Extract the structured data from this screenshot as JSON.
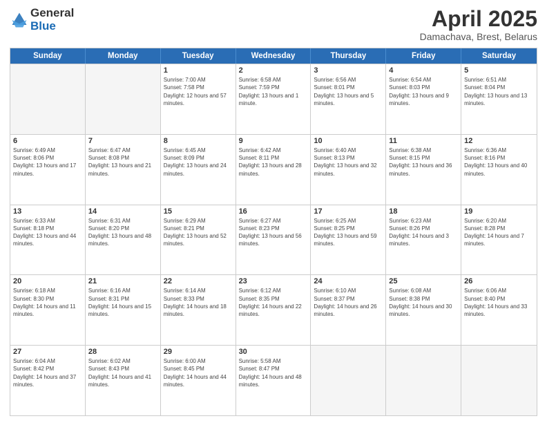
{
  "header": {
    "logo_general": "General",
    "logo_blue": "Blue",
    "month_title": "April 2025",
    "subtitle": "Damachava, Brest, Belarus"
  },
  "weekdays": [
    "Sunday",
    "Monday",
    "Tuesday",
    "Wednesday",
    "Thursday",
    "Friday",
    "Saturday"
  ],
  "weeks": [
    [
      {
        "day": "",
        "empty": true
      },
      {
        "day": "",
        "empty": true
      },
      {
        "day": "1",
        "sunrise": "Sunrise: 7:00 AM",
        "sunset": "Sunset: 7:58 PM",
        "daylight": "Daylight: 12 hours and 57 minutes."
      },
      {
        "day": "2",
        "sunrise": "Sunrise: 6:58 AM",
        "sunset": "Sunset: 7:59 PM",
        "daylight": "Daylight: 13 hours and 1 minute."
      },
      {
        "day": "3",
        "sunrise": "Sunrise: 6:56 AM",
        "sunset": "Sunset: 8:01 PM",
        "daylight": "Daylight: 13 hours and 5 minutes."
      },
      {
        "day": "4",
        "sunrise": "Sunrise: 6:54 AM",
        "sunset": "Sunset: 8:03 PM",
        "daylight": "Daylight: 13 hours and 9 minutes."
      },
      {
        "day": "5",
        "sunrise": "Sunrise: 6:51 AM",
        "sunset": "Sunset: 8:04 PM",
        "daylight": "Daylight: 13 hours and 13 minutes."
      }
    ],
    [
      {
        "day": "6",
        "sunrise": "Sunrise: 6:49 AM",
        "sunset": "Sunset: 8:06 PM",
        "daylight": "Daylight: 13 hours and 17 minutes."
      },
      {
        "day": "7",
        "sunrise": "Sunrise: 6:47 AM",
        "sunset": "Sunset: 8:08 PM",
        "daylight": "Daylight: 13 hours and 21 minutes."
      },
      {
        "day": "8",
        "sunrise": "Sunrise: 6:45 AM",
        "sunset": "Sunset: 8:09 PM",
        "daylight": "Daylight: 13 hours and 24 minutes."
      },
      {
        "day": "9",
        "sunrise": "Sunrise: 6:42 AM",
        "sunset": "Sunset: 8:11 PM",
        "daylight": "Daylight: 13 hours and 28 minutes."
      },
      {
        "day": "10",
        "sunrise": "Sunrise: 6:40 AM",
        "sunset": "Sunset: 8:13 PM",
        "daylight": "Daylight: 13 hours and 32 minutes."
      },
      {
        "day": "11",
        "sunrise": "Sunrise: 6:38 AM",
        "sunset": "Sunset: 8:15 PM",
        "daylight": "Daylight: 13 hours and 36 minutes."
      },
      {
        "day": "12",
        "sunrise": "Sunrise: 6:36 AM",
        "sunset": "Sunset: 8:16 PM",
        "daylight": "Daylight: 13 hours and 40 minutes."
      }
    ],
    [
      {
        "day": "13",
        "sunrise": "Sunrise: 6:33 AM",
        "sunset": "Sunset: 8:18 PM",
        "daylight": "Daylight: 13 hours and 44 minutes."
      },
      {
        "day": "14",
        "sunrise": "Sunrise: 6:31 AM",
        "sunset": "Sunset: 8:20 PM",
        "daylight": "Daylight: 13 hours and 48 minutes."
      },
      {
        "day": "15",
        "sunrise": "Sunrise: 6:29 AM",
        "sunset": "Sunset: 8:21 PM",
        "daylight": "Daylight: 13 hours and 52 minutes."
      },
      {
        "day": "16",
        "sunrise": "Sunrise: 6:27 AM",
        "sunset": "Sunset: 8:23 PM",
        "daylight": "Daylight: 13 hours and 56 minutes."
      },
      {
        "day": "17",
        "sunrise": "Sunrise: 6:25 AM",
        "sunset": "Sunset: 8:25 PM",
        "daylight": "Daylight: 13 hours and 59 minutes."
      },
      {
        "day": "18",
        "sunrise": "Sunrise: 6:23 AM",
        "sunset": "Sunset: 8:26 PM",
        "daylight": "Daylight: 14 hours and 3 minutes."
      },
      {
        "day": "19",
        "sunrise": "Sunrise: 6:20 AM",
        "sunset": "Sunset: 8:28 PM",
        "daylight": "Daylight: 14 hours and 7 minutes."
      }
    ],
    [
      {
        "day": "20",
        "sunrise": "Sunrise: 6:18 AM",
        "sunset": "Sunset: 8:30 PM",
        "daylight": "Daylight: 14 hours and 11 minutes."
      },
      {
        "day": "21",
        "sunrise": "Sunrise: 6:16 AM",
        "sunset": "Sunset: 8:31 PM",
        "daylight": "Daylight: 14 hours and 15 minutes."
      },
      {
        "day": "22",
        "sunrise": "Sunrise: 6:14 AM",
        "sunset": "Sunset: 8:33 PM",
        "daylight": "Daylight: 14 hours and 18 minutes."
      },
      {
        "day": "23",
        "sunrise": "Sunrise: 6:12 AM",
        "sunset": "Sunset: 8:35 PM",
        "daylight": "Daylight: 14 hours and 22 minutes."
      },
      {
        "day": "24",
        "sunrise": "Sunrise: 6:10 AM",
        "sunset": "Sunset: 8:37 PM",
        "daylight": "Daylight: 14 hours and 26 minutes."
      },
      {
        "day": "25",
        "sunrise": "Sunrise: 6:08 AM",
        "sunset": "Sunset: 8:38 PM",
        "daylight": "Daylight: 14 hours and 30 minutes."
      },
      {
        "day": "26",
        "sunrise": "Sunrise: 6:06 AM",
        "sunset": "Sunset: 8:40 PM",
        "daylight": "Daylight: 14 hours and 33 minutes."
      }
    ],
    [
      {
        "day": "27",
        "sunrise": "Sunrise: 6:04 AM",
        "sunset": "Sunset: 8:42 PM",
        "daylight": "Daylight: 14 hours and 37 minutes."
      },
      {
        "day": "28",
        "sunrise": "Sunrise: 6:02 AM",
        "sunset": "Sunset: 8:43 PM",
        "daylight": "Daylight: 14 hours and 41 minutes."
      },
      {
        "day": "29",
        "sunrise": "Sunrise: 6:00 AM",
        "sunset": "Sunset: 8:45 PM",
        "daylight": "Daylight: 14 hours and 44 minutes."
      },
      {
        "day": "30",
        "sunrise": "Sunrise: 5:58 AM",
        "sunset": "Sunset: 8:47 PM",
        "daylight": "Daylight: 14 hours and 48 minutes."
      },
      {
        "day": "",
        "empty": true
      },
      {
        "day": "",
        "empty": true
      },
      {
        "day": "",
        "empty": true
      }
    ]
  ]
}
